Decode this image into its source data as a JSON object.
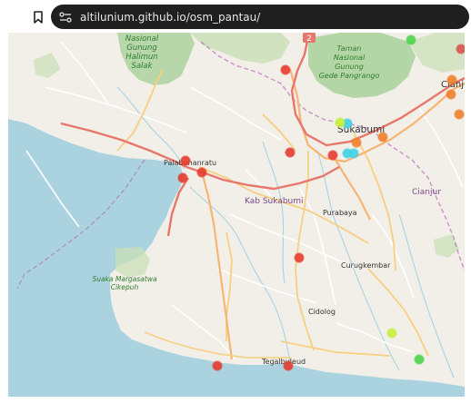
{
  "browser": {
    "url": "altilunium.github.io/osm_pantau/",
    "bookmark_icon": "bookmark-icon",
    "site_icon": "site-settings-icon"
  },
  "map": {
    "labels": {
      "halimun": [
        "Nasional",
        "Gunung",
        "Halimun",
        "Salak"
      ],
      "gede": [
        "Taman",
        "Nasional",
        "Gunung",
        "Gede Pangrango"
      ],
      "cianjur_top": "Cianju",
      "sukabumi": "Sukabumi",
      "palabuhanratu": "Palabuhanratu",
      "kab_sukabumi": "Kab Sukabumi",
      "purabaya": "Purabaya",
      "cianjur": "Cianjur",
      "curugkembar": "Curugkembar",
      "suaka": [
        "Suaka Margasatwa",
        "Cikepuh"
      ],
      "cidolog": "Cidolog",
      "tegalbuleud": "Tegalbuleud",
      "road_badge": "2"
    },
    "colors": {
      "land": "#f2efe9",
      "sea": "#aad3df",
      "forest": "#add19e",
      "park_green": "#c8dfb5",
      "admin_border": "#ac46ac",
      "road_primary": "#f7b573",
      "road_trunk": "#e8776b",
      "road_secondary": "#f7cf80",
      "road_minor": "#ffffff",
      "river": "#aad3df",
      "label_dark": "#333333",
      "label_admin": "#7d4a8c",
      "label_park": "#2f7f2f"
    },
    "markers": [
      {
        "color": "#e63b2e"
      },
      {
        "color": "#e63b2e"
      },
      {
        "color": "#e63b2e"
      },
      {
        "color": "#e63b2e"
      },
      {
        "color": "#e63b2e"
      },
      {
        "color": "#e63b2e"
      },
      {
        "color": "#e63b2e"
      },
      {
        "color": "#e63b2e"
      },
      {
        "color": "#e63b2e"
      },
      {
        "color": "#f07f2a"
      },
      {
        "color": "#f07f2a"
      },
      {
        "color": "#f07f2a"
      },
      {
        "color": "#f07f2a"
      },
      {
        "color": "#f07f2a"
      },
      {
        "color": "#3fd0e6"
      },
      {
        "color": "#3fd0e6"
      },
      {
        "color": "#3fd0e6"
      },
      {
        "color": "#c6ee3a"
      },
      {
        "color": "#c6ee3a"
      },
      {
        "color": "#4ad44a"
      },
      {
        "color": "#4ad44a"
      },
      {
        "color": "#d9534f"
      }
    ]
  }
}
